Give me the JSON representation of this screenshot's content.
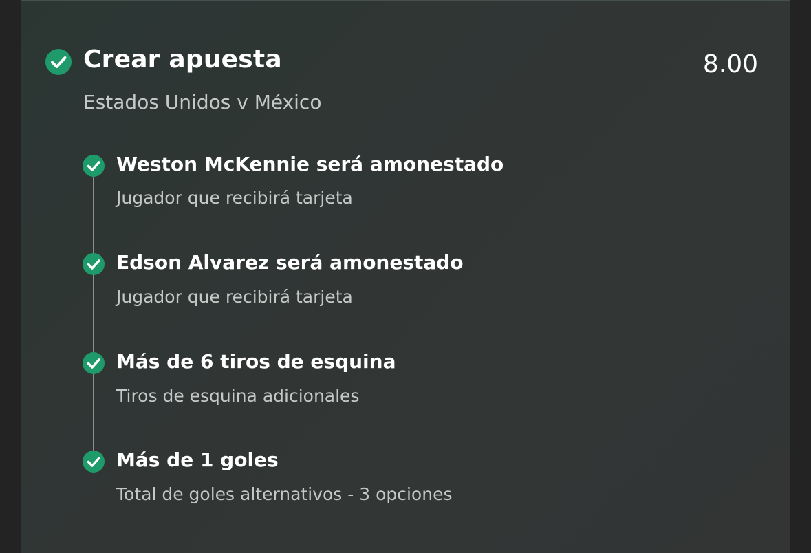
{
  "bet": {
    "title": "Crear apuesta",
    "odds": "8.00",
    "match": "Estados Unidos v México",
    "legs": [
      {
        "title": "Weston McKennie será amonestado",
        "subtitle": "Jugador que recibirá tarjeta"
      },
      {
        "title": "Edson Alvarez será amonestado",
        "subtitle": "Jugador que recibirá tarjeta"
      },
      {
        "title": "Más de 6 tiros de esquina",
        "subtitle": "Tiros de esquina adicionales"
      },
      {
        "title": "Más de 1 goles",
        "subtitle": "Total de goles alternativos - 3 opciones"
      }
    ]
  },
  "icons": {
    "status": "check-circle-icon"
  },
  "colors": {
    "accent_green": "#1f9a6b",
    "panel_bg": "#303534",
    "text_primary": "#ffffff",
    "text_secondary": "#c4c8c6"
  }
}
